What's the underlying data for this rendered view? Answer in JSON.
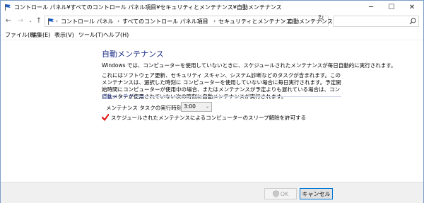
{
  "window": {
    "title": "コントロール パネル¥すべてのコントロール パネル項目¥セキュリティとメンテナンス¥自動メンテナンス",
    "min": "─",
    "max": "☐",
    "close": "✕"
  },
  "nav": {
    "back": "←",
    "forward": "→",
    "up": "↑",
    "sep": "›",
    "breadcrumbs": [
      "コントロール パネル",
      "すべてのコントロール パネル項目",
      "セキュリティとメンテナンス",
      "自動メンテナンス"
    ],
    "dropdown": "⌄",
    "refresh": "↻",
    "search_placeholder": ""
  },
  "menu": [
    "ファイル(F)",
    "編集(E)",
    "表示(V)",
    "ツール(T)",
    "ヘルプ(H)"
  ],
  "page": {
    "title": "自動メンテナンス",
    "para1": "Windows では、コンピューターを使用していないときに、スケジュールされたメンテナンスが毎日自動的に実行されます。",
    "para2": "これにはソフトウェア更新、セキュリティ スキャン、システム診断などのタスクが含まれます。このメンテナンスは、選択した時刻に コンピューターを使用していない場合に毎日実行されます。予定開始時間にコンピューターが使用中の場合、またはメンテナンスが予定よりも遅れている場合は、コンピューターが使用されていない次の時刻に自動メンテナンスが実行されます。",
    "section": "自動メンテナンス",
    "time_label": "メンテナンス タスクの実行時刻 (毎日):",
    "time_value": "3:00",
    "time_arrow": "⌄",
    "checkbox_label": "スケジュールされたメンテナンスによるコンピューターのスリープ解除を許可する",
    "checkbox_checked": true
  },
  "footer": {
    "ok": "OK",
    "cancel": "キャンセル"
  },
  "colors": {
    "title_blue": "#1e3287",
    "check_red": "#e01b1b",
    "focus_blue": "#0078d7"
  }
}
